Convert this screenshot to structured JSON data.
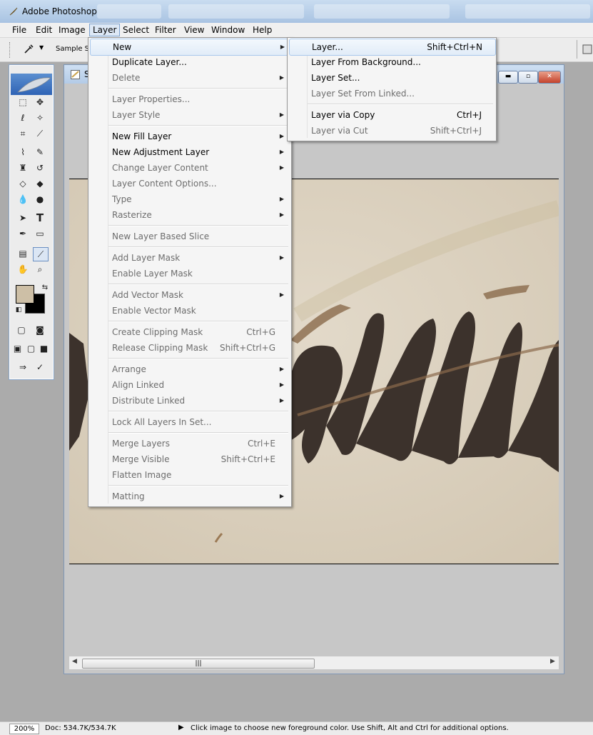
{
  "window": {
    "title": "Adobe Photoshop"
  },
  "menubar": {
    "items": [
      "File",
      "Edit",
      "Image",
      "Layer",
      "Select",
      "Filter",
      "View",
      "Window",
      "Help"
    ],
    "active": "Layer"
  },
  "options_bar": {
    "sample_label": "Sample Siz"
  },
  "document": {
    "title_fragment": "S"
  },
  "layer_menu": {
    "items": [
      {
        "label": "New",
        "enabled": true,
        "submenu": true
      },
      {
        "label": "Duplicate Layer...",
        "enabled": true
      },
      {
        "label": "Delete",
        "enabled": false,
        "submenu": true
      },
      {
        "label": "Layer Properties...",
        "enabled": false
      },
      {
        "label": "Layer Style",
        "enabled": false,
        "submenu": true
      },
      {
        "label": "New Fill Layer",
        "enabled": true,
        "submenu": true
      },
      {
        "label": "New Adjustment Layer",
        "enabled": true,
        "submenu": true
      },
      {
        "label": "Change Layer Content",
        "enabled": false,
        "submenu": true
      },
      {
        "label": "Layer Content Options...",
        "enabled": false
      },
      {
        "label": "Type",
        "enabled": false,
        "submenu": true
      },
      {
        "label": "Rasterize",
        "enabled": false,
        "submenu": true
      },
      {
        "label": "New Layer Based Slice",
        "enabled": false
      },
      {
        "label": "Add Layer Mask",
        "enabled": false,
        "submenu": true
      },
      {
        "label": "Enable Layer Mask",
        "enabled": false
      },
      {
        "label": "Add Vector Mask",
        "enabled": false,
        "submenu": true
      },
      {
        "label": "Enable Vector Mask",
        "enabled": false
      },
      {
        "label": "Create Clipping Mask",
        "enabled": false,
        "shortcut": "Ctrl+G"
      },
      {
        "label": "Release Clipping Mask",
        "enabled": false,
        "shortcut": "Shift+Ctrl+G"
      },
      {
        "label": "Arrange",
        "enabled": false,
        "submenu": true
      },
      {
        "label": "Align Linked",
        "enabled": false,
        "submenu": true
      },
      {
        "label": "Distribute Linked",
        "enabled": false,
        "submenu": true
      },
      {
        "label": "Lock All Layers In Set...",
        "enabled": false
      },
      {
        "label": "Merge Layers",
        "enabled": false,
        "shortcut": "Ctrl+E"
      },
      {
        "label": "Merge Visible",
        "enabled": false,
        "shortcut": "Shift+Ctrl+E"
      },
      {
        "label": "Flatten Image",
        "enabled": false
      },
      {
        "label": "Matting",
        "enabled": false,
        "submenu": true
      }
    ]
  },
  "new_submenu": {
    "items": [
      {
        "label": "Layer...",
        "enabled": true,
        "shortcut": "Shift+Ctrl+N"
      },
      {
        "label": "Layer From Background...",
        "enabled": true
      },
      {
        "label": "Layer Set...",
        "enabled": true
      },
      {
        "label": "Layer Set From Linked...",
        "enabled": false
      },
      {
        "label": "Layer via Copy",
        "enabled": true,
        "shortcut": "Ctrl+J"
      },
      {
        "label": "Layer via Cut",
        "enabled": false,
        "shortcut": "Shift+Ctrl+J"
      }
    ]
  },
  "status_bar": {
    "zoom": "200%",
    "doc_info": "Doc: 534.7K/534.7K",
    "hint": "Click image to choose new foreground color.  Use Shift, Alt and Ctrl for additional options."
  },
  "colors": {
    "foreground": "#cdbfa6",
    "background": "#000000",
    "ink": "#3c322c"
  }
}
